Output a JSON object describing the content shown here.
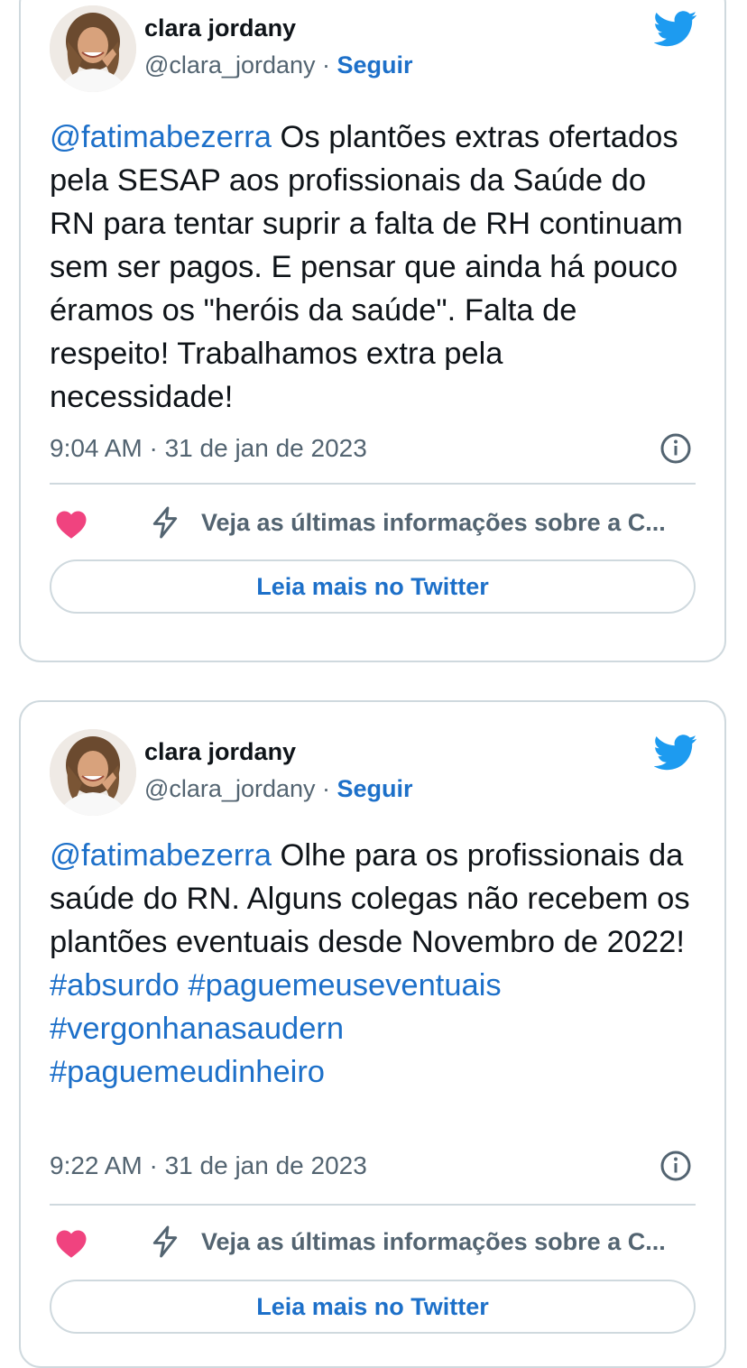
{
  "colors": {
    "accent": "#1d70c9",
    "twitter_blue": "#1d9bf0",
    "heart": "#f0437f",
    "muted": "#536471",
    "border": "#cfd9de"
  },
  "icons": {
    "twitter": "twitter-bird-icon",
    "info": "info-icon",
    "like": "heart-icon",
    "latest": "lightning-bolt-icon"
  },
  "tweets": [
    {
      "author_name": "clara jordany",
      "handle": "@clara_jordany",
      "separator": " · ",
      "follow_label": "Seguir",
      "mention": "@fatimabezerra",
      "body": " Os plantões extras ofertados pela SESAP aos profissionais da Saúde do RN para tentar suprir a falta de RH continuam sem ser pagos. E pensar que ainda há pouco éramos os \"heróis da saúde\". Falta de respeito! Trabalhamos extra pela necessidade!",
      "hashtags": [],
      "timestamp": "9:04 AM · 31 de jan de 2023",
      "latest_label": "Veja as últimas informações sobre a C...",
      "read_more_label": "Leia mais no Twitter"
    },
    {
      "author_name": "clara jordany",
      "handle": "@clara_jordany",
      "separator": " · ",
      "follow_label": "Seguir",
      "mention": "@fatimabezerra",
      "body": " Olhe para os profissionais da saúde do RN. Alguns colegas não recebem os plantões eventuais desde Novembro de 2022!",
      "hashtags": [
        "#absurdo",
        "#paguemeuseventuais",
        "#vergonhanasaudern",
        "#paguemeudinheiro"
      ],
      "timestamp": "9:22 AM · 31 de jan de 2023",
      "latest_label": "Veja as últimas informações sobre a C...",
      "read_more_label": "Leia mais no Twitter"
    }
  ]
}
